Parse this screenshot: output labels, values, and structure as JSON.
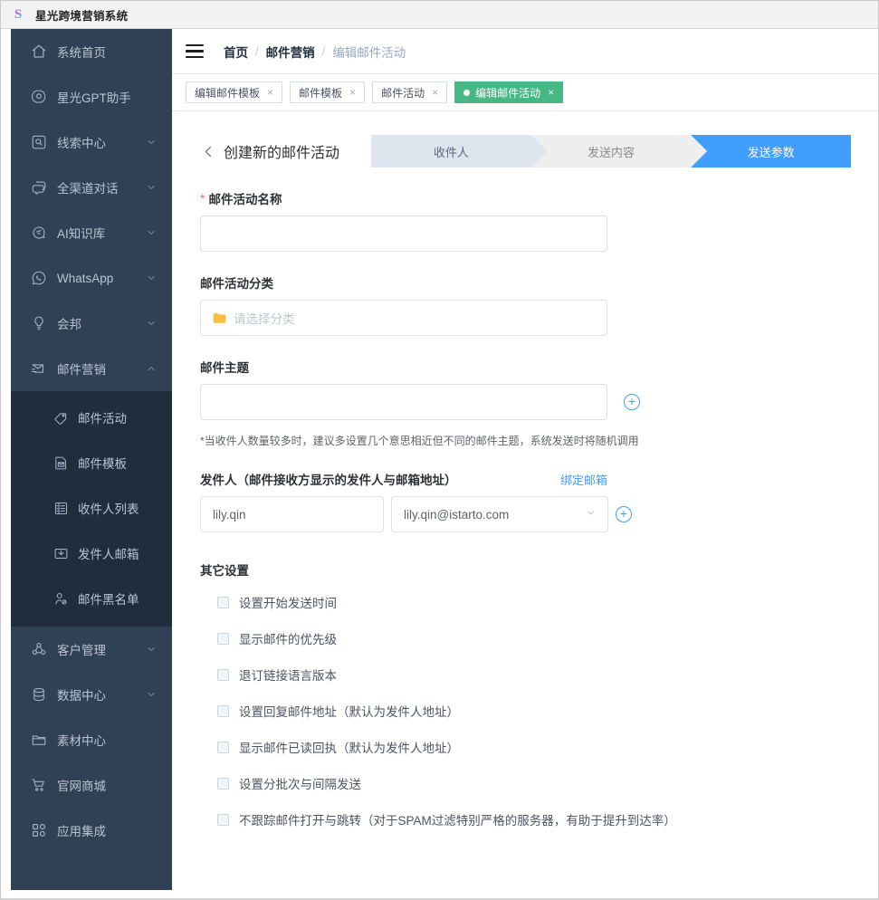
{
  "window": {
    "title": "星光跨境营销系统",
    "logo_letter": "S",
    "logo_icon": "starlight-logo-icon"
  },
  "sidebar": {
    "items": [
      {
        "label": "系统首页",
        "icon": "home-icon",
        "has_arrow": false,
        "expanded": false
      },
      {
        "label": "星光GPT助手",
        "icon": "gpt-icon",
        "has_arrow": false,
        "expanded": false
      },
      {
        "label": "线索中心",
        "icon": "lead-search-icon",
        "has_arrow": true,
        "expanded": false
      },
      {
        "label": "全渠道对话",
        "icon": "chat-bubble-icon",
        "has_arrow": true,
        "expanded": false
      },
      {
        "label": "AI知识库",
        "icon": "ai-brain-icon",
        "has_arrow": true,
        "expanded": false
      },
      {
        "label": "WhatsApp",
        "icon": "whatsapp-icon",
        "has_arrow": true,
        "expanded": false
      },
      {
        "label": "会邦",
        "icon": "bulb-icon",
        "has_arrow": true,
        "expanded": false
      },
      {
        "label": "邮件营销",
        "icon": "mail-send-icon",
        "has_arrow": true,
        "expanded": true
      }
    ],
    "submenu": [
      {
        "label": "邮件活动",
        "icon": "tag-icon"
      },
      {
        "label": "邮件模板",
        "icon": "template-icon"
      },
      {
        "label": "收件人列表",
        "icon": "list-icon"
      },
      {
        "label": "发件人邮箱",
        "icon": "inbox-icon"
      },
      {
        "label": "邮件黑名单",
        "icon": "user-block-icon"
      }
    ],
    "items_after": [
      {
        "label": "客户管理",
        "icon": "customers-icon",
        "has_arrow": true
      },
      {
        "label": "数据中心",
        "icon": "database-icon",
        "has_arrow": true
      },
      {
        "label": "素材中心",
        "icon": "folder-icon",
        "has_arrow": false
      },
      {
        "label": "官网商城",
        "icon": "cart-icon",
        "has_arrow": false
      },
      {
        "label": "应用集成",
        "icon": "apps-grid-icon",
        "has_arrow": false
      }
    ]
  },
  "header": {
    "menu_icon": "hamburger-icon",
    "breadcrumb": [
      {
        "label": "首页",
        "muted": false
      },
      {
        "label": "邮件营销",
        "muted": false
      },
      {
        "label": "编辑邮件活动",
        "muted": true
      }
    ],
    "separator": "/"
  },
  "tabs": [
    {
      "label": "编辑邮件模板",
      "active": false,
      "close": "×"
    },
    {
      "label": "邮件模板",
      "active": false,
      "close": "×"
    },
    {
      "label": "邮件活动",
      "active": false,
      "close": "×"
    },
    {
      "label": "编辑邮件活动",
      "active": true,
      "close": "×"
    }
  ],
  "page": {
    "back_icon": "chevron-left-icon",
    "title": "创建新的邮件活动",
    "steps": [
      {
        "label": "收件人",
        "state": "done"
      },
      {
        "label": "发送内容",
        "state": "done"
      },
      {
        "label": "发送参数",
        "state": "active"
      }
    ]
  },
  "form": {
    "name_label": "邮件活动名称",
    "name_required_mark": "*",
    "name_value": "",
    "name_placeholder": "",
    "category_label": "邮件活动分类",
    "category_placeholder": "请选择分类",
    "category_icon": "folder-yellow-icon",
    "subject_label": "邮件主题",
    "subject_value": "",
    "subject_add_icon": "plus-circle-icon",
    "subject_hint": "*当收件人数量较多时，建议多设置几个意思相近但不同的邮件主题，系统发送时将随机调用",
    "sender_label": "发件人（邮件接收方显示的发件人与邮箱地址）",
    "bind_mailbox_link": "绑定邮箱",
    "sender_name_value": "lily.qin",
    "sender_mail_value": "lily.qin@istarto.com",
    "sender_mail_caret": "chevron-down-icon",
    "sender_add_icon": "plus-circle-icon"
  },
  "other_settings": {
    "title": "其它设置",
    "options": [
      {
        "label": "设置开始发送时间",
        "checked": false
      },
      {
        "label": "显示邮件的优先级",
        "checked": false
      },
      {
        "label": "退订链接语言版本",
        "checked": false
      },
      {
        "label": "设置回复邮件地址（默认为发件人地址）",
        "checked": false
      },
      {
        "label": "显示邮件已读回执（默认为发件人地址）",
        "checked": false
      },
      {
        "label": "设置分批次与间隔发送",
        "checked": false
      },
      {
        "label": "不跟踪邮件打开与跳转（对于SPAM过滤特别严格的服务器，有助于提升到达率）",
        "checked": false
      }
    ]
  },
  "colors": {
    "sidebar_bg": "#304156",
    "submenu_bg": "#1f2d3d",
    "active_tab_green": "#47b785",
    "step_active_blue": "#409eff",
    "step_done_blue_gray": "#dde5ee",
    "step_gray": "#eeeeee",
    "link_blue": "#409eff",
    "required_red": "#f56c6c"
  }
}
